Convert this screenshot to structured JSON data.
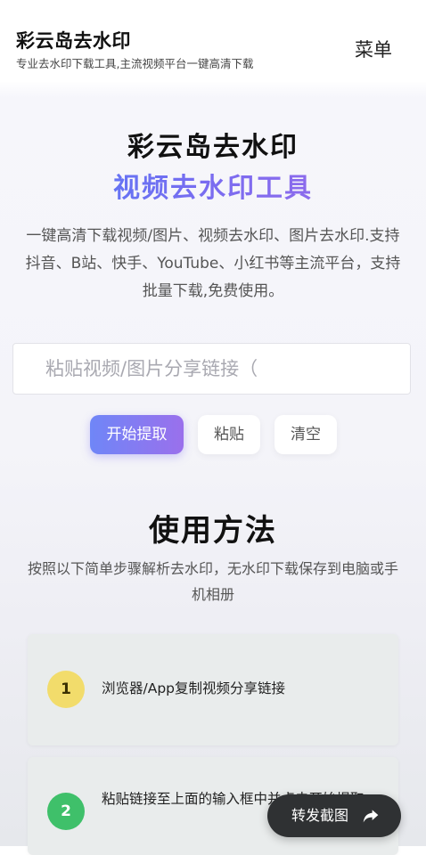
{
  "header": {
    "title": "彩云岛去水印",
    "subtitle": "专业去水印下载工具,主流视频平台一键高清下载",
    "menu_label": "菜单"
  },
  "hero": {
    "title": "彩云岛去水印",
    "subtitle": "视频去水印工具",
    "description": "一键高清下载视频/图片、视频去水印、图片去水印.支持抖音、B站、快手、YouTube、小红书等主流平台，支持批量下载,免费使用。"
  },
  "search": {
    "placeholder": "粘贴视频/图片分享链接（",
    "value": ""
  },
  "actions": {
    "start_label": "开始提取",
    "paste_label": "粘贴",
    "clear_label": "清空"
  },
  "usage": {
    "title": "使用方法",
    "description": "按照以下简单步骤解析去水印，无水印下载保存到电脑或手机相册",
    "steps": [
      {
        "number": "1",
        "text": "浏览器/App复制视频分享链接"
      },
      {
        "number": "2",
        "text": "粘贴链接至上面的输入框中并点击开始提取"
      }
    ]
  },
  "share": {
    "label": "转发截图",
    "icon": "share-arrow-icon"
  },
  "colors": {
    "accent_start": "#6f86f7",
    "accent_end": "#9a70ec",
    "step1": "#f2dc6b",
    "step2": "#3fc06a",
    "share_bg": "#2f3133"
  }
}
